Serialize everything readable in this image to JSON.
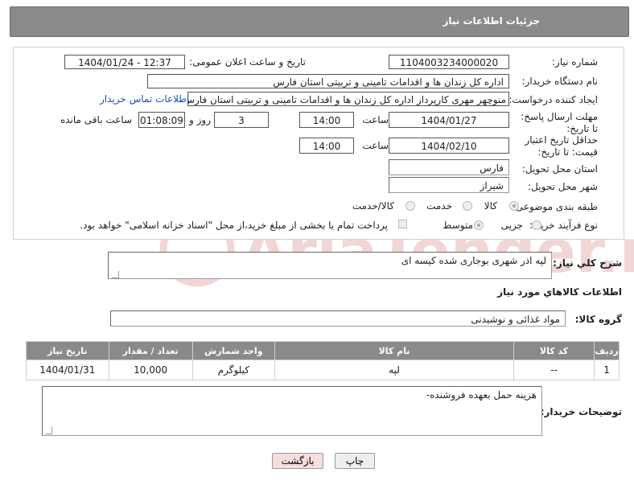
{
  "header": {
    "title": "جزئیات اطلاعات نیاز"
  },
  "fields": {
    "need_number_label": "شماره نیاز:",
    "need_number": "1104003234000020",
    "announce_label": "تاریخ و ساعت اعلان عمومی:",
    "announce_value": "1404/01/24 - 12:37",
    "buyer_label": "نام دستگاه خریدار:",
    "buyer_value": "اداره کل زندان ها و اقدامات تامینی و تربیتی استان فارس",
    "creator_label": "ایجاد کننده درخواست:",
    "creator_value": "منوچهر  مهری  کارپرداز اداره کل زندان ها و اقدامات تامینی و تربیتی استان فارس",
    "contact_link": "اطلاعات تماس خریدار",
    "deadline_label": "مهلت ارسال پاسخ: تا تاریخ:",
    "deadline_date": "1404/01/27",
    "deadline_time_label": "ساعت",
    "deadline_time": "14:00",
    "days_value": "3",
    "days_label": "روز و",
    "remaining_time": "01:08:09",
    "remaining_label": "ساعت باقی مانده",
    "validity_label": "حداقل تاریخ اعتبار قیمت: تا تاریخ:",
    "validity_date": "1404/02/10",
    "validity_time_label": "ساعت",
    "validity_time": "14:00",
    "province_label": "استان محل تحویل:",
    "province_value": "فارس",
    "city_label": "شهر محل تحویل:",
    "city_value": "شیراز",
    "category_label": "طبقه بندی موضوعی:",
    "category_options": [
      "کالا",
      "خدمت",
      "کالا/خدمت"
    ],
    "process_label": "نوع فرآیند خرید :",
    "process_options": [
      "جزیی",
      "متوسط"
    ],
    "payment_note": "پرداخت تمام یا بخشی از مبلغ خرید،از محل \"اسناد خزانه اسلامی\" خواهد بود."
  },
  "description": {
    "label": "شرح کلي نياز:",
    "value": "لپه اذر شهری بوجاری شده کیسه ای"
  },
  "goods_info": {
    "title": "اطلاعات کالاهاي مورد نياز",
    "group_label": "گروه کالا:",
    "group_value": "مواد غذائی و نوشیدنی"
  },
  "table": {
    "headers": [
      "ردیف",
      "کد کالا",
      "نام کالا",
      "واحد شمارش",
      "تعداد / مقدار",
      "تاریخ نیاز"
    ],
    "rows": [
      [
        "1",
        "--",
        "لپه",
        "کیلوگرم",
        "10,000",
        "1404/01/31"
      ]
    ]
  },
  "buyer_notes": {
    "label": "توضیحات خریدار:",
    "value": "هزینه حمل بعهده فروشنده-"
  },
  "buttons": {
    "print": "چاپ",
    "back": "بازگشت"
  },
  "watermark": {
    "text": "AriaTender.neT"
  },
  "colors": {
    "header_bg": "#8a8a8a",
    "link": "#1a4fb3",
    "back_button_bg": "#f6dede"
  }
}
